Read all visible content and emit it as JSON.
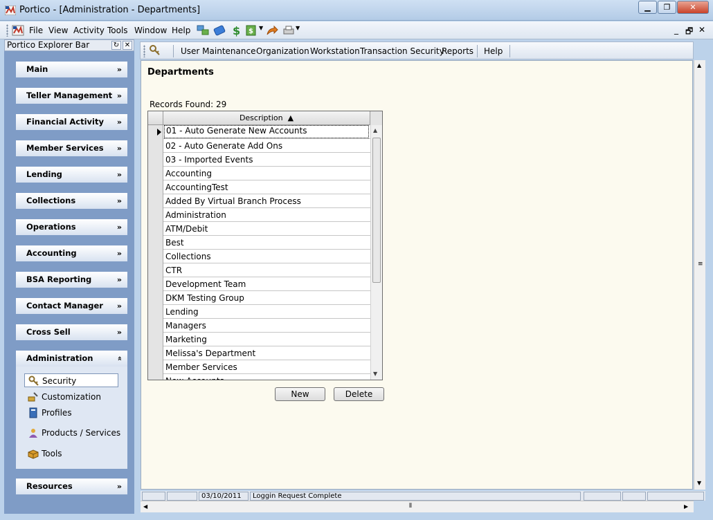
{
  "window": {
    "title": "Portico - [Administration - Departments]"
  },
  "menubar": {
    "items": [
      "File",
      "View",
      "Activity",
      "Tools",
      "Window",
      "Help"
    ],
    "mdi_controls": [
      "_",
      "🗗",
      "✕"
    ]
  },
  "explorer": {
    "title": "Portico Explorer Bar",
    "groups": [
      "Main",
      "Teller Management",
      "Financial Activity",
      "Member Services",
      "Lending",
      "Collections",
      "Operations",
      "Accounting",
      "BSA Reporting",
      "Contact Manager",
      "Cross Sell",
      "Administration",
      "Resources"
    ],
    "admin_tasks": [
      {
        "label": "Security",
        "icon": "key-icon"
      },
      {
        "label": "Customization",
        "icon": "tools-icon"
      },
      {
        "label": "Profiles",
        "icon": "profiles-icon"
      },
      {
        "label": "Products / Services",
        "icon": "products-icon"
      },
      {
        "label": "Tools",
        "icon": "toolbox-icon"
      }
    ]
  },
  "secmenu": {
    "items": [
      "User Maintenance",
      "Organization",
      "Workstation",
      "Transaction Security",
      "Reports",
      "Help"
    ]
  },
  "page": {
    "title": "Departments",
    "records_found": "Records Found: 29",
    "grid": {
      "column": "Description",
      "rows": [
        "01 - Auto Generate New Accounts",
        "02 - Auto Generate Add Ons",
        "03 - Imported Events",
        "Accounting",
        "AccountingTest",
        "Added By Virtual Branch Process",
        "Administration",
        "ATM/Debit",
        "Best",
        "Collections",
        "CTR",
        "Development Team",
        "DKM Testing Group",
        "Lending",
        "Managers",
        "Marketing",
        "Melissa's Department",
        "Member Services",
        "New Accounts"
      ]
    },
    "buttons": {
      "new": "New",
      "delete": "Delete"
    }
  },
  "status": {
    "date": "03/10/2011",
    "message": "Loggin Request Complete"
  },
  "colors": {
    "explorer_bg": "#7f9cc6",
    "page_bg": "#fcfaef",
    "frame_bg": "#bcd2ea"
  }
}
